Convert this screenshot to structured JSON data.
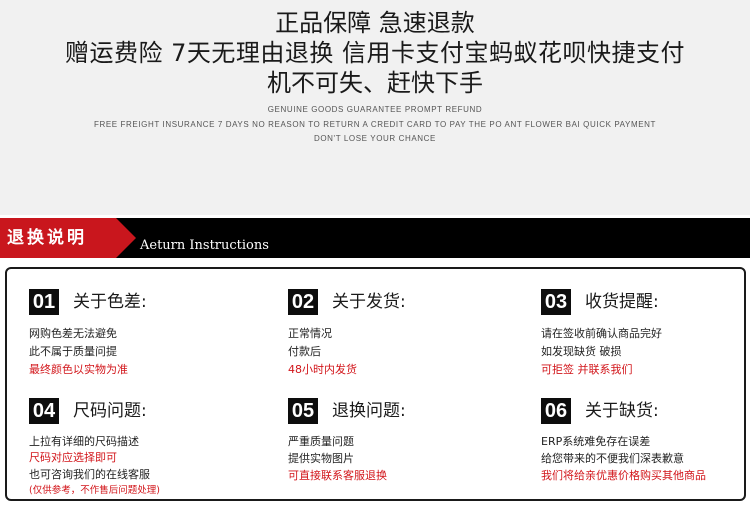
{
  "banner": {
    "line1": "正品保障 急速退款",
    "line2": "赠运费险 7天无理由退换 信用卡支付宝蚂蚁花呗快捷支付",
    "line3": "机不可失、赶快下手",
    "eng1": "GENUINE GOODS GUARANTEE PROMPT REFUND",
    "eng2": "FREE FREIGHT INSURANCE 7 DAYS NO REASON TO RETURN A CREDIT CARD TO PAY THE PO ANT FLOWER BAI QUICK PAYMENT",
    "eng3": "DON'T LOSE YOUR CHANCE"
  },
  "section": {
    "title_cn": "退换说明",
    "title_en": "Aeturn Instructions"
  },
  "items": [
    {
      "num": "01",
      "title": "关于色差:",
      "lines": [
        "网购色差无法避免",
        "此不属于质量问提",
        "最终颜色以实物为准"
      ]
    },
    {
      "num": "02",
      "title": "关于发货:",
      "lines": [
        "正常情况",
        "付款后",
        "48小时内发货"
      ]
    },
    {
      "num": "03",
      "title": "收货提醒:",
      "lines": [
        "请在签收前确认商品完好",
        "如发现缺货 破损",
        "可拒签 并联系我们"
      ]
    },
    {
      "num": "04",
      "title": "尺码问题:",
      "lines": [
        "上拉有详细的尺码描述",
        "尺码对应选择即可",
        "也可咨询我们的在线客服",
        "(仅供参考，不作售后问题处理)"
      ]
    },
    {
      "num": "05",
      "title": "退换问题:",
      "lines": [
        "严重质量问题",
        "提供实物图片",
        "可直接联系客服退换"
      ]
    },
    {
      "num": "06",
      "title": "关于缺货:",
      "lines": [
        "ERP系统难免存在误差",
        "给您带来的不便我们深表歉意",
        "我们将给亲优惠价格购买其他商品"
      ]
    }
  ],
  "colors": {
    "accent_red": "#c9161d",
    "text_red": "#d2151a",
    "bar_black": "#000000"
  }
}
